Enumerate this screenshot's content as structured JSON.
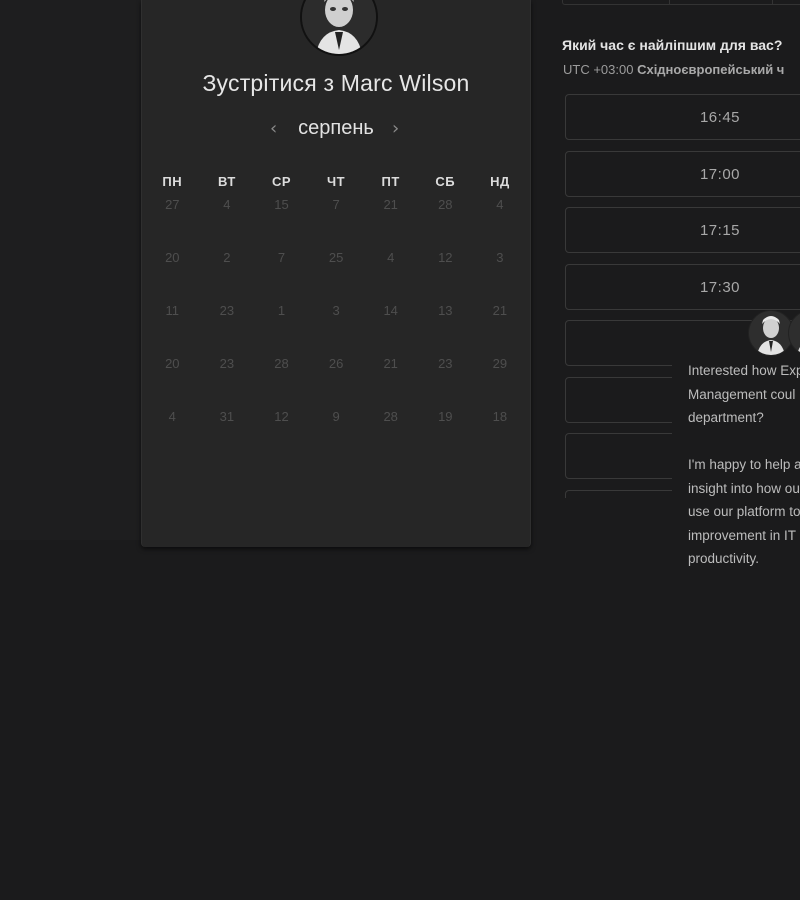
{
  "calendar": {
    "title": "Зустрітися з Marc Wilson",
    "month": "серпень",
    "prev_icon": "chevron-left-icon",
    "next_icon": "chevron-right-icon",
    "weekdays": [
      "ПН",
      "ВТ",
      "СР",
      "ЧТ",
      "ПТ",
      "СБ",
      "НД"
    ],
    "weeks": [
      [
        "27",
        "4",
        "15",
        "7",
        "21",
        "28",
        "4"
      ],
      [
        "20",
        "2",
        "7",
        "25",
        "4",
        "12",
        "3"
      ],
      [
        "11",
        "23",
        "1",
        "3",
        "14",
        "13",
        "21"
      ],
      [
        "20",
        "23",
        "28",
        "26",
        "21",
        "23",
        "29"
      ],
      [
        "4",
        "31",
        "12",
        "9",
        "28",
        "19",
        "18"
      ]
    ]
  },
  "times": {
    "question": "Який час є найліпшим для вас?",
    "tz_offset": "UTC +03:00",
    "tz_name": "Східноєвропейський ч",
    "slots": [
      "16:45",
      "17:00",
      "17:15",
      "17:30",
      "",
      "",
      ""
    ]
  },
  "chat": {
    "message": "Interested how Exp\nManagement coul\ndepartment?\n\nI'm happy to help a\ninsight into how ou\nuse our platform to\nimprovement in IT \nproductivity."
  },
  "colors": {
    "page_bg": "#1b1b1c",
    "card_bg": "#262626",
    "slot_border": "#393939"
  }
}
